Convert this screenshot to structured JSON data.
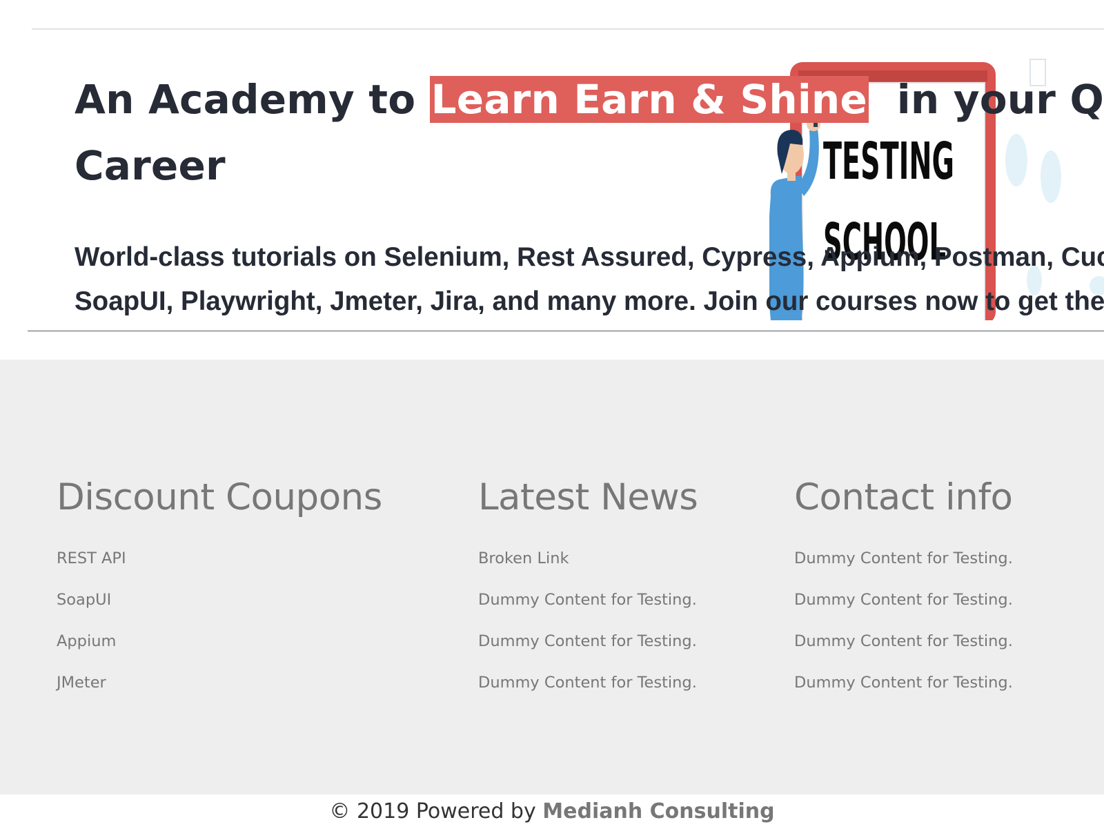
{
  "hero": {
    "headline_before": "An Academy to ",
    "headline_highlight": "Learn Earn & Shine",
    "headline_after": "  in your QA",
    "headline_line2": "Career",
    "subtext_line1": "World-class tutorials on Selenium, Rest Assured, Cypress, Appium, Postman, Cucumber,",
    "subtext_line2": "SoapUI, Playwright, Jmeter, Jira, and many more. Join our courses now to get the best",
    "illustration": {
      "line1": "TESTING",
      "line2": "SCHOOL"
    }
  },
  "footer": {
    "coupons": {
      "title": "Discount Coupons",
      "items": [
        "REST API",
        "SoapUI",
        "Appium",
        "JMeter"
      ]
    },
    "news": {
      "title": "Latest News",
      "items": [
        "Broken Link",
        "Dummy Content for Testing.",
        "Dummy Content for Testing.",
        "Dummy Content for Testing."
      ]
    },
    "contact": {
      "title": "Contact info",
      "items": [
        "Dummy Content for Testing.",
        "Dummy Content for Testing.",
        "Dummy Content for Testing.",
        "Dummy Content for Testing."
      ]
    }
  },
  "copyright": {
    "prefix": "© 2019 Powered by ",
    "link": "Medianh Consulting"
  },
  "colors": {
    "highlight": "#df5f5a",
    "text_dark": "#262b36",
    "footer_bg": "#eeeeee",
    "footer_text": "#777777"
  }
}
